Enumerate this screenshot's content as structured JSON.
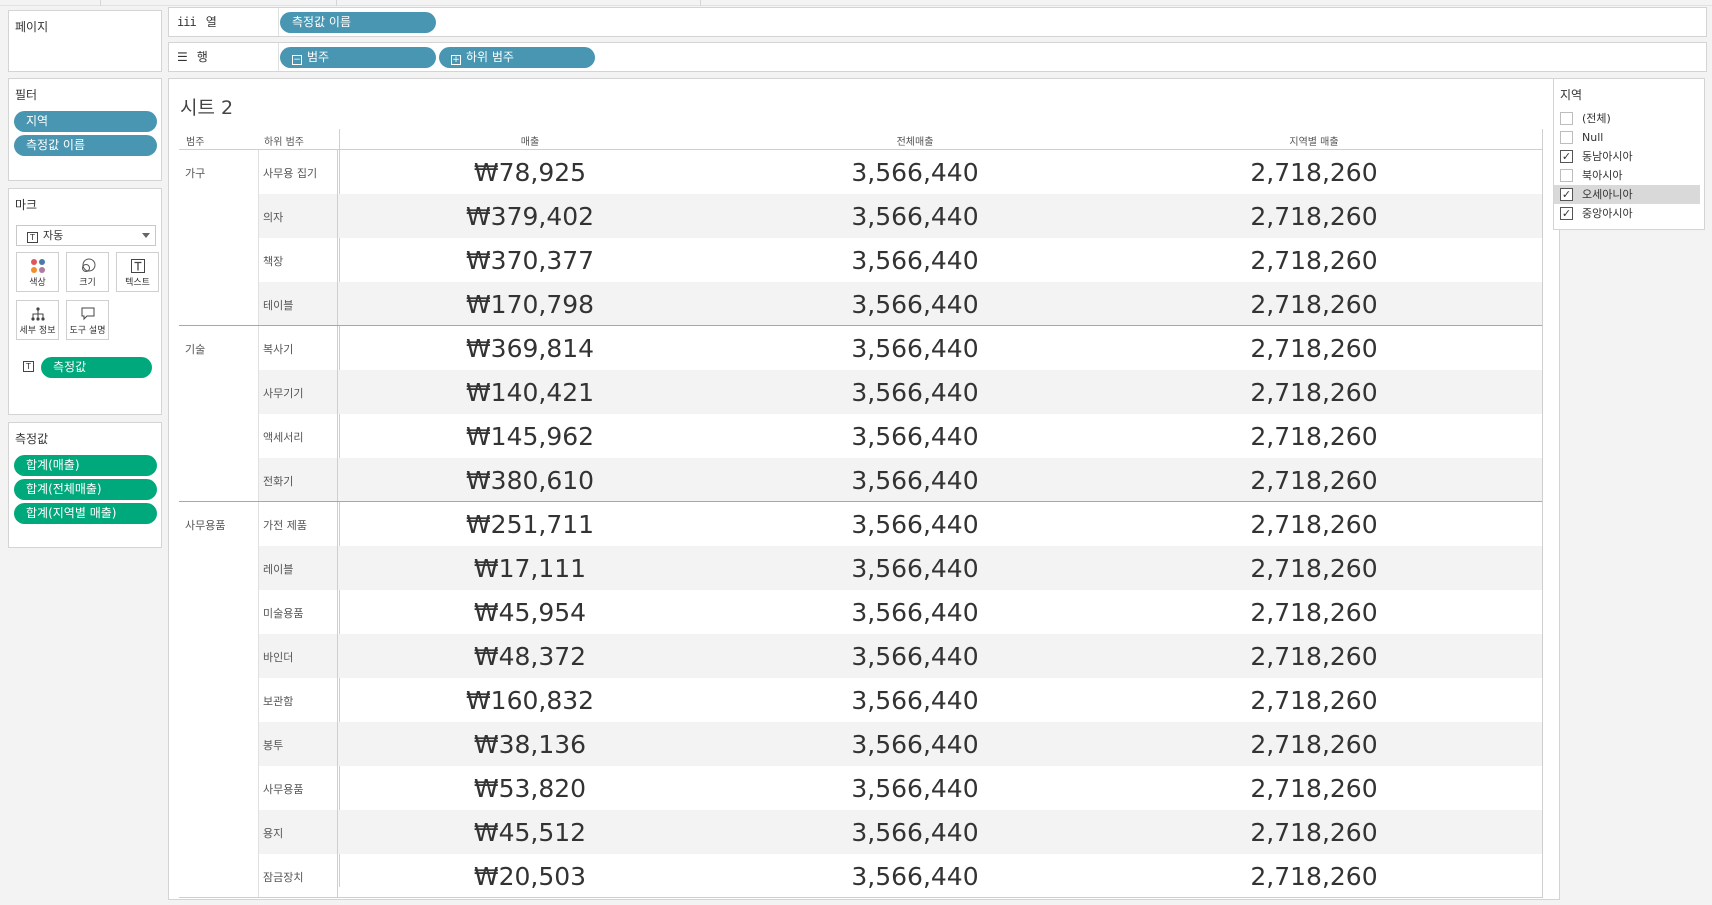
{
  "cards": {
    "pages_title": "페이지",
    "filters_title": "필터",
    "marks_title": "마크",
    "measures_title": "측정값"
  },
  "filters": [
    "지역",
    "측정값 이름"
  ],
  "marks": {
    "type_label": "자동",
    "buttons": [
      {
        "label": "색상",
        "icon": "color-icon"
      },
      {
        "label": "크기",
        "icon": "size-icon"
      },
      {
        "label": "텍스트",
        "icon": "text-icon"
      },
      {
        "label": "세부 정보",
        "icon": "detail-icon"
      },
      {
        "label": "도구 설명",
        "icon": "tooltip-icon"
      }
    ],
    "pill": "측정값"
  },
  "measures": [
    "합계(매출)",
    "합계(전체매출)",
    "합계(지역별 매출)"
  ],
  "shelves": {
    "columns_label": "열",
    "columns_pill": "측정값 이름",
    "rows_label": "행",
    "rows_pills": [
      "범주",
      "하위 범주"
    ]
  },
  "sheet": {
    "title": "시트 2",
    "headers": {
      "category": "범주",
      "subcategory": "하위 범주",
      "sales": "매출",
      "total_sales": "전체매출",
      "region_sales": "지역별 매출"
    },
    "groups": [
      {
        "category": "가구",
        "rows": [
          {
            "sub": "사무용 집기",
            "sales": "₩78,925",
            "total": "3,566,440",
            "region": "2,718,260"
          },
          {
            "sub": "의자",
            "sales": "₩379,402",
            "total": "3,566,440",
            "region": "2,718,260"
          },
          {
            "sub": "책장",
            "sales": "₩370,377",
            "total": "3,566,440",
            "region": "2,718,260"
          },
          {
            "sub": "테이블",
            "sales": "₩170,798",
            "total": "3,566,440",
            "region": "2,718,260"
          }
        ]
      },
      {
        "category": "기술",
        "rows": [
          {
            "sub": "복사기",
            "sales": "₩369,814",
            "total": "3,566,440",
            "region": "2,718,260"
          },
          {
            "sub": "사무기기",
            "sales": "₩140,421",
            "total": "3,566,440",
            "region": "2,718,260"
          },
          {
            "sub": "액세서리",
            "sales": "₩145,962",
            "total": "3,566,440",
            "region": "2,718,260"
          },
          {
            "sub": "전화기",
            "sales": "₩380,610",
            "total": "3,566,440",
            "region": "2,718,260"
          }
        ]
      },
      {
        "category": "사무용품",
        "rows": [
          {
            "sub": "가전 제품",
            "sales": "₩251,711",
            "total": "3,566,440",
            "region": "2,718,260"
          },
          {
            "sub": "레이블",
            "sales": "₩17,111",
            "total": "3,566,440",
            "region": "2,718,260"
          },
          {
            "sub": "미술용품",
            "sales": "₩45,954",
            "total": "3,566,440",
            "region": "2,718,260"
          },
          {
            "sub": "바인더",
            "sales": "₩48,372",
            "total": "3,566,440",
            "region": "2,718,260"
          },
          {
            "sub": "보관함",
            "sales": "₩160,832",
            "total": "3,566,440",
            "region": "2,718,260"
          },
          {
            "sub": "봉투",
            "sales": "₩38,136",
            "total": "3,566,440",
            "region": "2,718,260"
          },
          {
            "sub": "사무용품",
            "sales": "₩53,820",
            "total": "3,566,440",
            "region": "2,718,260"
          },
          {
            "sub": "용지",
            "sales": "₩45,512",
            "total": "3,566,440",
            "region": "2,718,260"
          },
          {
            "sub": "잠금장치",
            "sales": "₩20,503",
            "total": "3,566,440",
            "region": "2,718,260"
          }
        ]
      }
    ]
  },
  "region_filter": {
    "title": "지역",
    "items": [
      {
        "label": "(전체)",
        "checked": false
      },
      {
        "label": "Null",
        "checked": false
      },
      {
        "label": "동남아시아",
        "checked": true
      },
      {
        "label": "북아시아",
        "checked": false
      },
      {
        "label": "오세아니아",
        "checked": true,
        "highlighted": true
      },
      {
        "label": "중앙아시아",
        "checked": true
      }
    ]
  },
  "colors": {
    "dimension_pill": "#4996b2",
    "measure_pill": "#00a97c",
    "row_band": "#f3f3f3"
  }
}
